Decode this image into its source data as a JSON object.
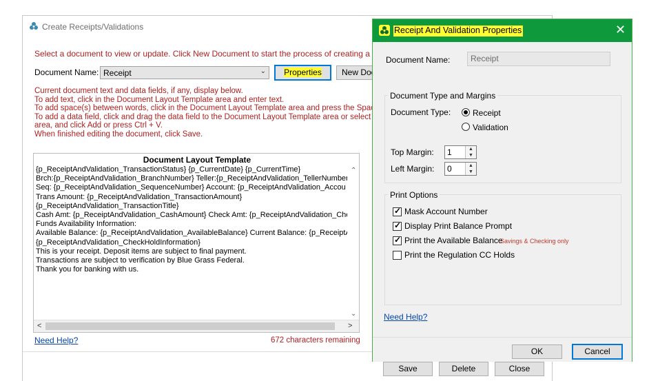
{
  "main": {
    "title": "Create Receipts/Validations",
    "intro": "Select a document to view or update.  Click New Document to start the process of creating a new do",
    "doc_name_label": "Document Name:",
    "doc_name_value": "Receipt",
    "properties_button": "Properties",
    "new_doc_button": "New Doc",
    "instructions": [
      "Current document text and data fields, if any, display below.",
      "To add text, click in the Document Layout Template area and enter text.",
      "To add space(s) between words, click in the Document Layout Template area and press the Space b",
      "To add a data field, click and drag the data field to the Document Layout Template area or select th",
      "area, and click Add or press Ctrl + V.",
      "When finished editing the document, click Save."
    ],
    "template_heading": "Document Layout Template",
    "template_lines": [
      "{p_ReceiptAndValidation_TransactionStatus}  {p_CurrentDate}  {p_CurrentTime}",
      "Brch:{p_ReceiptAndValidation_BranchNumber}  Teller:{p_ReceiptAndValidation_TellerNumber",
      "Seq: {p_ReceiptAndValidation_SequenceNumber}    Account: {p_ReceiptAndValidation_Accou",
      "Trans Amount: {p_ReceiptAndValidation_TransactionAmount}",
      "{p_ReceiptAndValidation_TransactionTitle}",
      "Cash Amt: {p_ReceiptAndValidation_CashAmount}  Check Amt: {p_ReceiptAndValidation_Che",
      "Funds Availability Information:",
      "Available Balance: {p_ReceiptAndValidation_AvailableBalance}  Current Balance: {p_ReceiptA",
      "{p_ReceiptAndValidation_CheckHoldInformation}",
      "This is your receipt.  Deposit items are subject to final payment.",
      "Transactions are subject to verification by Blue Grass Federal.",
      "Thank you for banking with us."
    ],
    "need_help": "Need Help?",
    "chars_remaining": "672 characters remaining",
    "save_button": "Save",
    "delete_button": "Delete",
    "close_button": "Close"
  },
  "dialog": {
    "title": "Receipt And Validation Properties",
    "doc_name_label": "Document Name:",
    "doc_name_value": "Receipt",
    "type_group_label": "Document Type and Margins",
    "doc_type_label": "Document Type:",
    "radio_receipt": "Receipt",
    "radio_validation": "Validation",
    "selected_type": "Receipt",
    "top_margin_label": "Top Margin:",
    "top_margin_value": "1",
    "left_margin_label": "Left Margin:",
    "left_margin_value": "0",
    "print_group_label": "Print Options",
    "options": [
      {
        "label": "Mask Account Number",
        "checked": true,
        "note": ""
      },
      {
        "label": "Display Print Balance Prompt",
        "checked": true,
        "note": ""
      },
      {
        "label": "Print the Available Balance",
        "checked": true,
        "note": "Savings & Checking only"
      },
      {
        "label": "Print the Regulation CC Holds",
        "checked": false,
        "note": ""
      }
    ],
    "need_help": "Need Help?",
    "ok_button": "OK",
    "cancel_button": "Cancel"
  },
  "colors": {
    "title_bar": "#0e9a3c",
    "highlight": "#ffff33",
    "instruction_red": "#b02020",
    "link": "#0645ad"
  }
}
